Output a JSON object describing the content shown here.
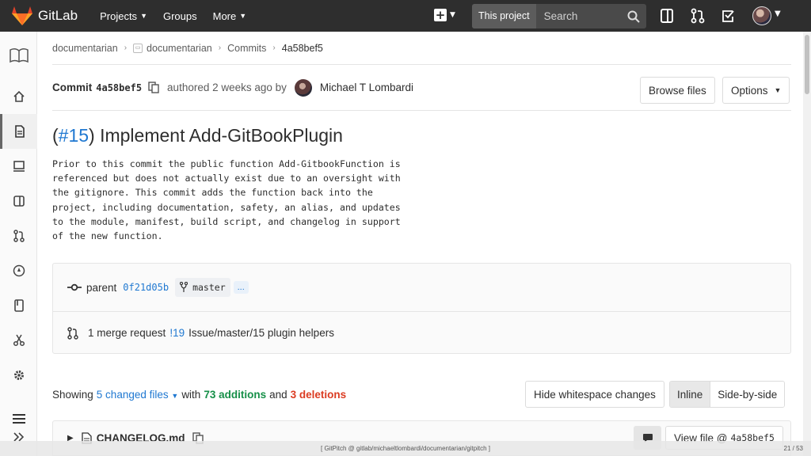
{
  "nav": {
    "brand": "GitLab",
    "projects": "Projects",
    "groups": "Groups",
    "more": "More",
    "scope": "This project",
    "search_placeholder": "Search"
  },
  "breadcrumb": {
    "group": "documentarian",
    "project": "documentarian",
    "commits": "Commits",
    "current": "4a58bef5"
  },
  "commit": {
    "label": "Commit",
    "sha": "4a58bef5",
    "authored": "authored 2 weeks ago by",
    "author": "Michael T Lombardi",
    "browse_files": "Browse files",
    "options": "Options",
    "title_open": "(",
    "title_link": "#15",
    "title_rest": ") Implement Add-GitBookPlugin",
    "description": "Prior to this commit the public function Add-GitbookFunction is\nreferenced but does not actually exist due to an oversight with\nthe gitignore. This commit adds the function back into the\nproject, including documentation, safety, an alias, and updates\nto the module, manifest, build script, and changelog in support\nof the new function."
  },
  "info": {
    "parent_label": "parent",
    "parent_sha": "0f21d05b",
    "branch": "master",
    "ellipsis": "...",
    "mr_text": "1 merge request",
    "mr_id": "!19",
    "mr_title": "Issue/master/15 plugin helpers"
  },
  "changes": {
    "showing": "Showing",
    "files": "5 changed files",
    "with": "with",
    "additions": "73 additions",
    "and": "and",
    "deletions": "3 deletions",
    "hide_ws": "Hide whitespace changes",
    "inline": "Inline",
    "side_by_side": "Side-by-side"
  },
  "file": {
    "name": "CHANGELOG.md",
    "view_file": "View file @",
    "view_sha": "4a58bef5"
  },
  "footer": {
    "text": "[ GitPitch @ gitlab/michaeltlombardi/documentarian/gitpitch ]",
    "page": "21 / 53"
  },
  "colors": {
    "nav_bg": "#2e2e2e",
    "link": "#1f78d1",
    "additions": "#168f48",
    "deletions": "#db3b21",
    "logo_orange": "#e24329"
  }
}
